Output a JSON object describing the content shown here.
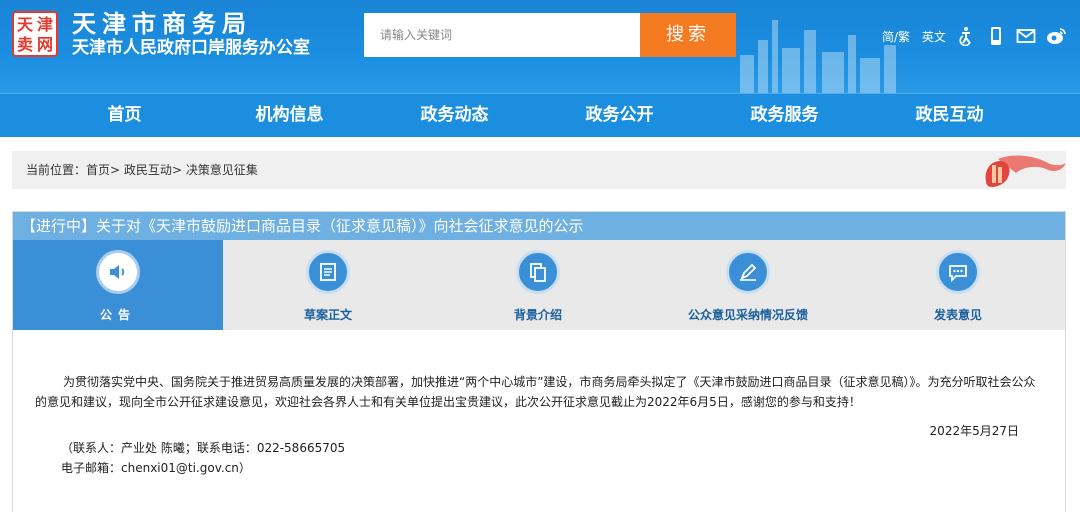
{
  "header": {
    "logo_chars": [
      "天",
      "津",
      "卖",
      "网"
    ],
    "title": "天津市商务局",
    "subtitle": "天津市人民政府口岸服务办公室",
    "search": {
      "placeholder": "请输入关键词",
      "button": "搜索"
    },
    "lang_switch": "简/繁",
    "english": "英文",
    "icons": [
      "accessibility-icon",
      "mobile-icon",
      "mail-icon",
      "weibo-icon"
    ],
    "colors": {
      "primary": "#1b8ee0",
      "search_button": "#f47b22"
    }
  },
  "nav": {
    "items": [
      "首页",
      "机构信息",
      "政务动态",
      "政务公开",
      "政务服务",
      "政民互动"
    ]
  },
  "breadcrumb": {
    "prefix": "当前位置：",
    "items": [
      "首页",
      "政民互动",
      "决策意见征集"
    ],
    "sep": ">"
  },
  "topic": {
    "title": "【进行中】关于对《天津市鼓励进口商品目录（征求意见稿）》向社会征求意见的公示",
    "tabs": [
      {
        "label": "公告",
        "icon": "speaker-icon",
        "active": true
      },
      {
        "label": "草案正文",
        "icon": "document-icon",
        "active": false
      },
      {
        "label": "背景介绍",
        "icon": "copy-icon",
        "active": false
      },
      {
        "label": "公众意见采纳情况反馈",
        "icon": "edit-icon",
        "active": false
      },
      {
        "label": "发表意见",
        "icon": "chat-icon",
        "active": false
      }
    ],
    "body": "为贯彻落实党中央、国务院关于推进贸易高质量发展的决策部署，加快推进“两个中心城市”建设，市商务局牵头拟定了《天津市鼓励进口商品目录（征求意见稿）》。为充分听取社会公众的意见和建议，现向全市公开征求建设意见，欢迎社会各界人士和有关单位提出宝贵建议，此次公开征求意见截止为2022年6月5日，感谢您的参与和支持！",
    "date": "2022年5月27日",
    "contact_line1": "（联系人：产业处 陈曦；联系电话：022-58665705",
    "contact_line2": "电子邮箱：chenxi01@ti.gov.cn）"
  }
}
